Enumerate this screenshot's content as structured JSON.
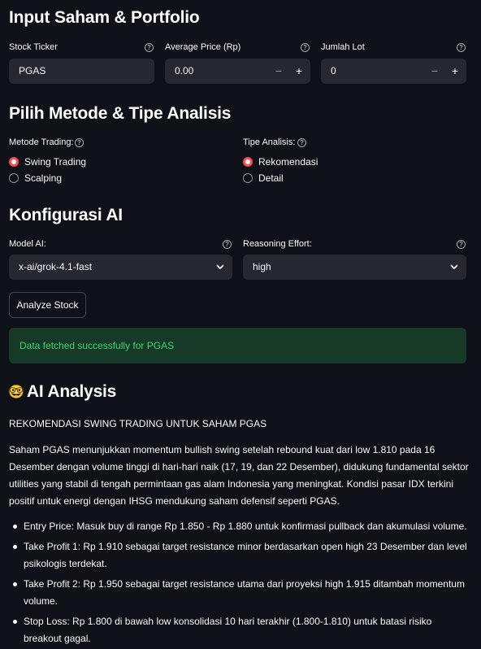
{
  "sections": {
    "input_title": "Input Saham & Portfolio",
    "method_title": "Pilih Metode & Tipe Analisis",
    "config_title": "Konfigurasi AI",
    "analysis_title": "AI Analysis",
    "analysis_icon": "🤓"
  },
  "inputs": {
    "ticker_label": "Stock Ticker",
    "ticker_value": "PGAS",
    "avg_price_label": "Average Price (Rp)",
    "avg_price_value": "0.00",
    "lot_label": "Jumlah Lot",
    "lot_value": "0",
    "minus": "−",
    "plus": "+",
    "help": "?"
  },
  "method": {
    "trading_label": "Metode Trading:",
    "trading_options": [
      "Swing Trading",
      "Scalping"
    ],
    "trading_selected": "Swing Trading",
    "analysis_label": "Tipe Analisis:",
    "analysis_options": [
      "Rekomendasi",
      "Detail"
    ],
    "analysis_selected": "Rekomendasi"
  },
  "config": {
    "model_label": "Model AI:",
    "model_value": "x-ai/grok-4.1-fast",
    "effort_label": "Reasoning Effort:",
    "effort_value": "high"
  },
  "actions": {
    "analyze_label": "Analyze Stock"
  },
  "status": {
    "success_message": "Data fetched successfully for PGAS"
  },
  "analysis": {
    "heading": "REKOMENDASI SWING TRADING UNTUK SAHAM PGAS",
    "summary": "Saham PGAS menunjukkan momentum bullish swing setelah rebound kuat dari low 1.810 pada 16 Desember dengan volume tinggi di hari-hari naik (17, 19, dan 22 Desember), didukung fundamental sektor utilities yang stabil di tengah permintaan gas alam Indonesia yang meningkat. Kondisi pasar IDX terkini positif untuk energi dengan IHSG mendukung saham defensif seperti PGAS.",
    "bullets": [
      "Entry Price: Masuk buy di range Rp 1.850 - Rp 1.880 untuk konfirmasi pullback dan akumulasi volume.",
      "Take Profit 1: Rp 1.910 sebagai target resistance minor berdasarkan open high 23 Desember dan level psikologis terdekat.",
      "Take Profit 2: Rp 1.950 sebagai target resistance utama dari proyeksi high 1.915 ditambah momentum volume.",
      "Stop Loss: Rp 1.800 di bawah low konsolidasi 10 hari terakhir (1.800-1.810) untuk batasi risiko breakout gagal."
    ]
  },
  "colors": {
    "background": "#0e1117",
    "input_bg": "#262730",
    "accent": "#ff4b4b",
    "success_bg": "#173928",
    "success_text": "#3dd56d"
  }
}
